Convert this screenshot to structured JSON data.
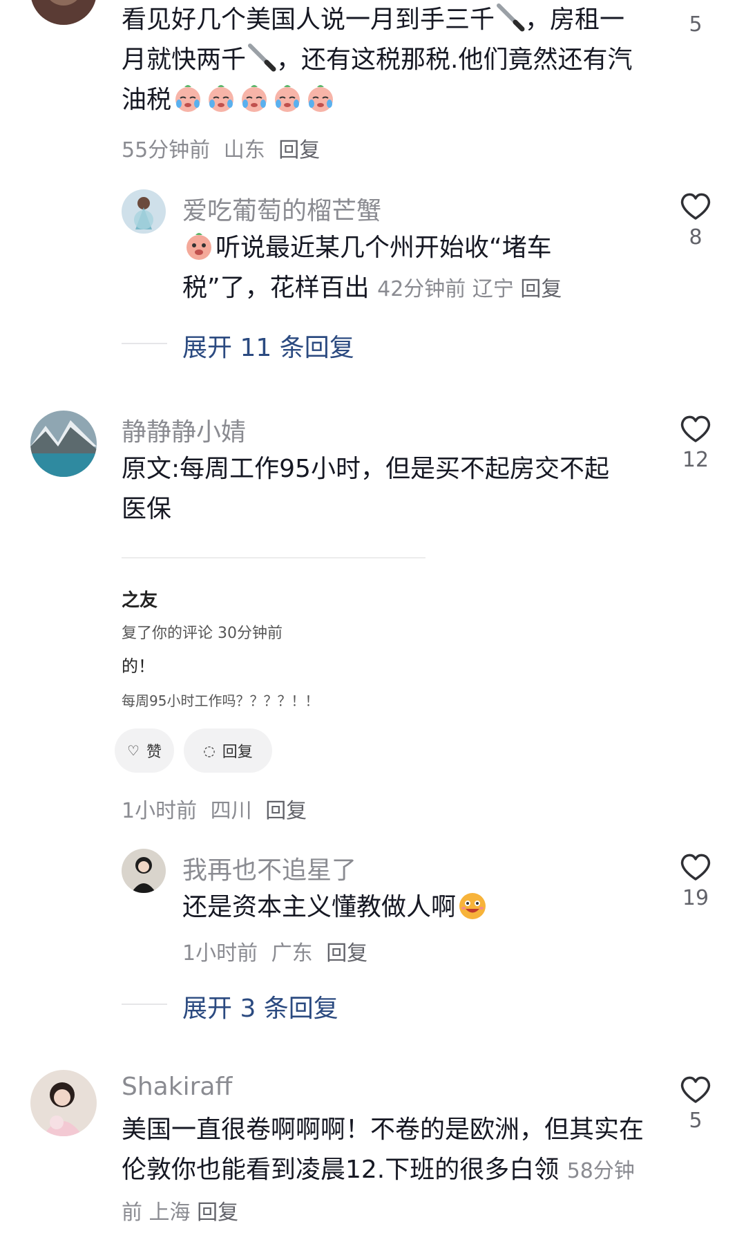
{
  "comment1": {
    "text_a": "看见好几个美国人说一月到手三千",
    "text_b": "，房租一月就快两千",
    "text_c": "，还有这税那税.他们竟然还有汽油税",
    "time": "55分钟前",
    "location": "山东",
    "reply_label": "回复",
    "likes": "5"
  },
  "reply1": {
    "username": "爱吃葡萄的榴芒蟹",
    "text": "听说最近某几个州开始收“堵车税”了，花样百出",
    "time": "42分钟前",
    "location": "辽宁",
    "reply_label": "回复",
    "likes": "8"
  },
  "expand1": "展开 11 条回复",
  "comment2": {
    "username": "静静静小婧",
    "text": "原文:每周工作95小时，但是买不起房交不起医保",
    "time": "1小时前",
    "location": "四川",
    "reply_label": "回复",
    "likes": "12",
    "screenshot": {
      "title": "之友",
      "line2": "复了你的评论  30分钟前",
      "line3": "的！",
      "line4": "每周95小时工作吗？？？？！！",
      "like_btn": "赞",
      "reply_btn": "回复"
    }
  },
  "reply2": {
    "username": "我再也不追星了",
    "text": "还是资本主义懂教做人啊",
    "time": "1小时前",
    "location": "广东",
    "reply_label": "回复",
    "likes": "19"
  },
  "expand2": "展开 3 条回复",
  "comment3": {
    "username": "Shakiraff",
    "text": "美国一直很卷啊啊啊！不卷的是欧洲，但其实在伦敦你也能看到凌晨12.下班的很多白领",
    "time": "58分钟前",
    "location": "上海",
    "reply_label": "回复",
    "likes": "5"
  },
  "colors": {
    "name": "#8a8b91",
    "expand": "#2b4a80",
    "text": "#161823"
  }
}
